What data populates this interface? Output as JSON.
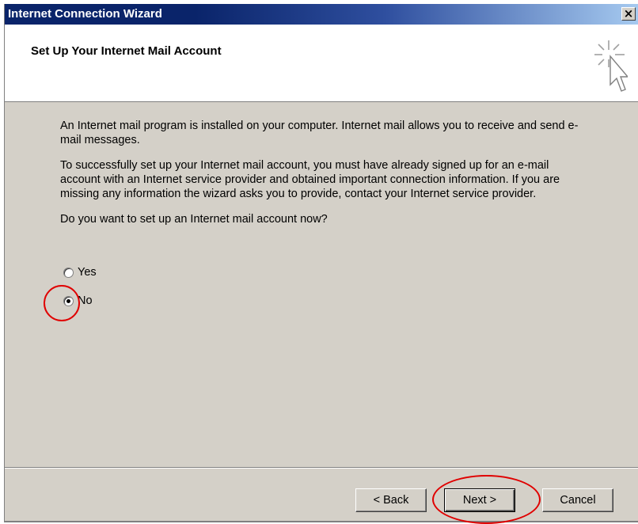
{
  "window": {
    "title": "Internet Connection Wizard",
    "close_label": "×"
  },
  "header": {
    "title": "Set Up Your Internet Mail Account",
    "icon": "wizard-cursor-sparkle-icon"
  },
  "body": {
    "paragraph1": "An Internet mail program is installed on your computer. Internet mail allows you to receive and send e-mail messages.",
    "paragraph2": "To successfully set up your Internet mail account, you must have already signed up for an e-mail account with an Internet service provider and obtained important connection information. If you are missing any information the wizard asks you to provide, contact your Internet service provider.",
    "question": "Do you want to set up an Internet mail account now?"
  },
  "options": {
    "yes_label": "Yes",
    "no_label": "No",
    "selected": "No"
  },
  "buttons": {
    "back": "< Back",
    "next": "Next >",
    "cancel": "Cancel"
  },
  "colors": {
    "titlebar": "#0a246a",
    "dialog_face": "#d4d0c8",
    "annotation": "#e00000"
  }
}
